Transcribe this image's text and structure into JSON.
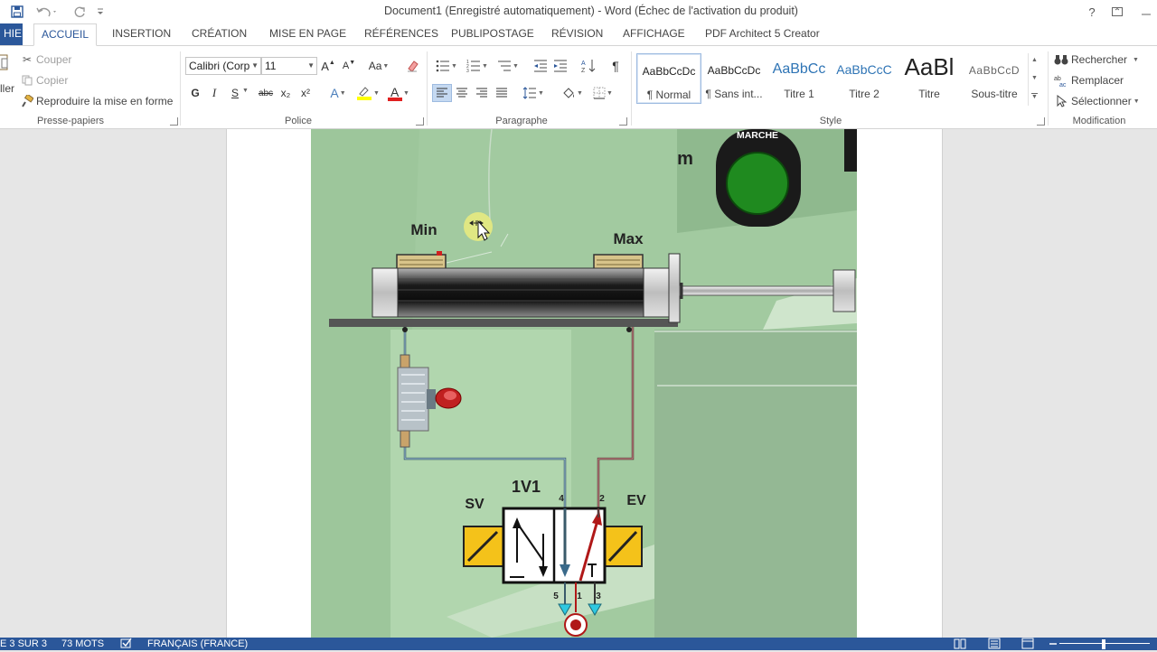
{
  "window": {
    "title": "Document1 (Enregistré automatiquement) - Word (Échec de l'activation du produit)",
    "help": "?"
  },
  "tabs": [
    {
      "label": "HIER"
    },
    {
      "label": "ACCUEIL"
    },
    {
      "label": "INSERTION"
    },
    {
      "label": "CRÉATION"
    },
    {
      "label": "MISE EN PAGE"
    },
    {
      "label": "RÉFÉRENCES"
    },
    {
      "label": "PUBLIPOSTAGE"
    },
    {
      "label": "RÉVISION"
    },
    {
      "label": "AFFICHAGE"
    },
    {
      "label": "PDF Architect 5 Creator"
    }
  ],
  "clipboard": {
    "paste_partial": "ller",
    "cut": "Couper",
    "copy": "Copier",
    "format_painter": "Reproduire la mise en forme",
    "group": "Presse-papiers"
  },
  "font": {
    "name": "Calibri (Corp",
    "size": "11",
    "group": "Police",
    "case_label": "Aa",
    "bold": "G",
    "italic": "I",
    "underline": "S",
    "strike": "abc",
    "subscript": "x₂",
    "superscript": "x²",
    "effects": "A",
    "color_letter": "A",
    "grow": "A",
    "shrink": "A"
  },
  "paragraph": {
    "group": "Paragraphe",
    "pilcrow": "¶"
  },
  "styles": {
    "group": "Style",
    "items": [
      {
        "sample": "AaBbCcDc",
        "name": "¶ Normal"
      },
      {
        "sample": "AaBbCcDc",
        "name": "¶ Sans int..."
      },
      {
        "sample": "AaBbCc",
        "name": "Titre 1"
      },
      {
        "sample": "AaBbCcC",
        "name": "Titre 2"
      },
      {
        "sample": "AaBl",
        "name": "Titre"
      },
      {
        "sample": "AaBbCcD",
        "name": "Sous-titre"
      }
    ]
  },
  "editing": {
    "find": "Rechercher",
    "replace": "Remplacer",
    "select": "Sélectionner",
    "group": "Modification"
  },
  "figure": {
    "marche": "MARCHE",
    "m_label": "m",
    "min": "Min",
    "max": "Max",
    "sv": "SV",
    "valve": "1V1",
    "ev": "EV",
    "port4": "4",
    "port2": "2",
    "port5": "5",
    "port1": "1",
    "port3": "3"
  },
  "status": {
    "page": "E 3 SUR 3",
    "words": "73 MOTS",
    "language": "FRANÇAIS (FRANCE)"
  },
  "colors": {
    "accent": "#2b579a",
    "green_bg": "#a2caa0",
    "lamp": "#1f8a1f",
    "solenoid": "#f4c21a"
  }
}
